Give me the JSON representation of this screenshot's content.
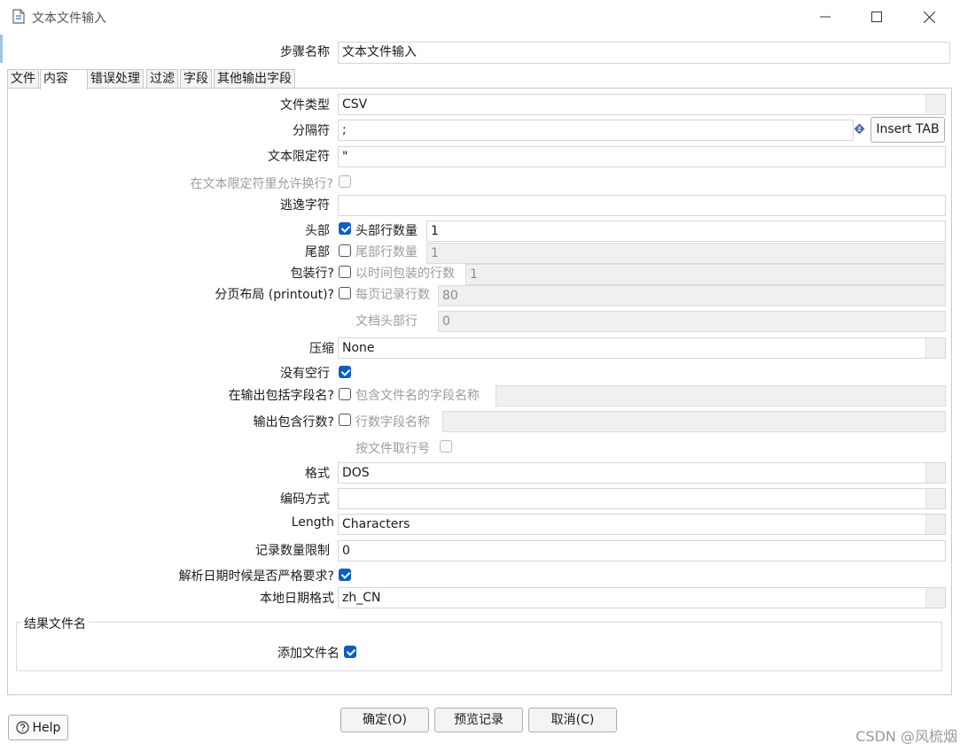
{
  "window": {
    "title": "文本文件输入"
  },
  "step_name": {
    "label": "步骤名称",
    "value": "文本文件输入"
  },
  "tabs": [
    "文件",
    "内容",
    "错误处理",
    "过滤",
    "字段",
    "其他输出字段"
  ],
  "active_tab": "内容",
  "content": {
    "file_type": {
      "label": "文件类型",
      "value": "CSV"
    },
    "separator": {
      "label": "分隔符",
      "value": ";",
      "insert_tab": "Insert TAB"
    },
    "enclosure": {
      "label": "文本限定符",
      "value": "\""
    },
    "allow_breaks": {
      "label": "在文本限定符里允许换行?"
    },
    "escape": {
      "label": "逃逸字符",
      "value": ""
    },
    "header": {
      "label": "头部",
      "check_label": "头部行数量",
      "value": "1",
      "checked": true
    },
    "footer": {
      "label": "尾部",
      "check_label": "尾部行数量",
      "value": "1",
      "checked": false
    },
    "wrap": {
      "label": "包装行?",
      "check_label": "以时间包装的行数",
      "value": "1",
      "checked": false
    },
    "paged": {
      "label": "分页布局 (printout)?",
      "check_label": "每页记录行数",
      "value": "80",
      "checked": false
    },
    "doc_header": {
      "label": "文档头部行",
      "value": "0"
    },
    "compression": {
      "label": "压缩",
      "value": "None"
    },
    "no_empty_rows": {
      "label": "没有空行",
      "checked": true
    },
    "include_filename": {
      "label": "在输出包括字段名?",
      "check_label": "包含文件名的字段名称",
      "value": "",
      "checked": false
    },
    "include_rownum": {
      "label": "输出包含行数?",
      "check_label": "行数字段名称",
      "value": "",
      "checked": false
    },
    "rownum_by_file": {
      "label": "按文件取行号",
      "checked": false
    },
    "format": {
      "label": "格式",
      "value": "DOS"
    },
    "encoding": {
      "label": "编码方式",
      "value": ""
    },
    "length": {
      "label": "Length",
      "value": "Characters"
    },
    "limit": {
      "label": "记录数量限制",
      "value": "0"
    },
    "date_lenient": {
      "label": "解析日期时候是否严格要求?",
      "checked": true
    },
    "date_locale": {
      "label": "本地日期格式",
      "value": "zh_CN"
    }
  },
  "result_group": {
    "title": "结果文件名",
    "add_filename": {
      "label": "添加文件名",
      "checked": true
    }
  },
  "buttons": {
    "help": "Help",
    "ok": "确定(O)",
    "preview": "预览记录",
    "cancel": "取消(C)"
  },
  "watermark": "CSDN @风梳烟"
}
